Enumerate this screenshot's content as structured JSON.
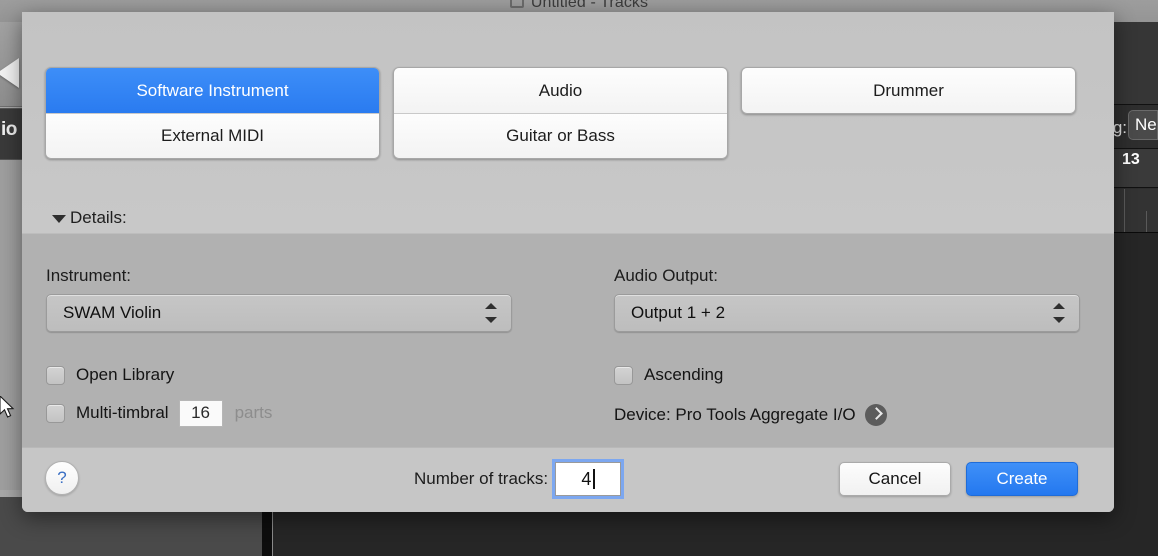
{
  "background": {
    "window_title": "Untitled - Tracks",
    "window_icon": "document-icon",
    "rewind_icon": "rewind-triangle-icon",
    "left_fragment_text": "io",
    "right_label_fragment": "g:",
    "right_pill_fragment": "Ne",
    "right_ruler_fragment": "13",
    "cursor_icon": "mouse-pointer-icon"
  },
  "dialog": {
    "type_groups": [
      {
        "group_name": "midi-group",
        "options": [
          {
            "label": "Software Instrument",
            "selected": true
          },
          {
            "label": "External MIDI",
            "selected": false
          }
        ]
      },
      {
        "group_name": "audio-group",
        "options": [
          {
            "label": "Audio",
            "selected": false
          },
          {
            "label": "Guitar or Bass",
            "selected": false
          }
        ]
      },
      {
        "group_name": "drummer-group",
        "options": [
          {
            "label": "Drummer",
            "selected": false
          }
        ]
      }
    ],
    "details": {
      "disclosure_label": "Details:",
      "disclosure_icon": "triangle-down-icon",
      "expanded": true,
      "instrument": {
        "label": "Instrument:",
        "value": "SWAM Violin",
        "arrows_icon": "updown-chevron-icon"
      },
      "audio_output": {
        "label": "Audio Output:",
        "value": "Output 1 + 2",
        "arrows_icon": "updown-chevron-icon"
      },
      "open_library": {
        "label": "Open Library",
        "checked": false
      },
      "multi_timbral": {
        "label": "Multi-timbral",
        "checked": false,
        "parts_value": "16",
        "parts_label": "parts"
      },
      "ascending": {
        "label": "Ascending",
        "checked": false
      },
      "device": {
        "text": "Device: Pro Tools Aggregate I/O",
        "arrow_icon": "chevron-right-circle-icon"
      }
    },
    "footer": {
      "help_label": "?",
      "help_icon": "question-mark-icon",
      "number_of_tracks_label": "Number of tracks:",
      "number_of_tracks_value": "4",
      "cancel_label": "Cancel",
      "create_label": "Create"
    }
  },
  "colors": {
    "accent_blue": "#3d8ef8",
    "create_blue": "#2478ef",
    "sheet_bg": "#c6c6c6",
    "details_bg": "#b1b1b1",
    "focus_ring": "#7ca7f0"
  }
}
